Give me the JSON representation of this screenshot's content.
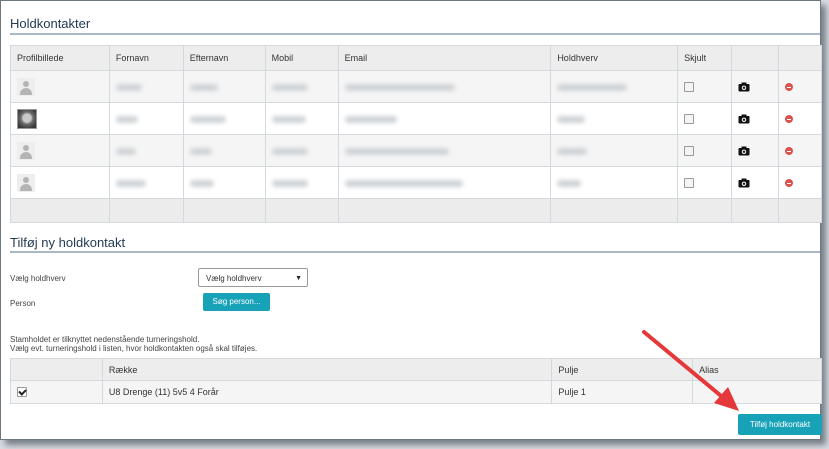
{
  "contacts_section": {
    "title": "Holdkontakter",
    "columns": [
      "Profilbillede",
      "Fornavn",
      "Efternavn",
      "Mobil",
      "Email",
      "Holdhverv",
      "Skjult",
      "",
      ""
    ],
    "rows": [
      {
        "avatar": "placeholder",
        "hidden": false
      },
      {
        "avatar": "photo",
        "hidden": false
      },
      {
        "avatar": "placeholder",
        "hidden": false
      },
      {
        "avatar": "placeholder",
        "hidden": false
      }
    ]
  },
  "add_section": {
    "title": "Tilføj ny holdkontakt",
    "role_label": "Vælg holdhverv",
    "role_select_value": "Vælg holdhverv",
    "person_label": "Person",
    "search_person_button": "Søg person...",
    "note_line1": "Stamholdet er tilknyttet nedenstående turneringshold.",
    "note_line2": "Vælg evt. turneringshold i listen, hvor holdkontakten også skal tilføjes.",
    "teams_table": {
      "columns": [
        "",
        "Række",
        "Pulje",
        "Alias"
      ],
      "rows": [
        {
          "checked": true,
          "row_name": "U8 Drenge (11) 5v5 4 Forår",
          "pool": "Pulje 1",
          "alias": ""
        }
      ]
    },
    "submit_button": "Tilføj holdkontakt"
  },
  "icons": {
    "camera": "camera-icon",
    "delete": "delete-icon",
    "avatar": "user-placeholder-icon",
    "dropdown": "caret-down-icon"
  },
  "colors": {
    "accent": "#17a2b8",
    "title": "#243a55",
    "delete": "#d9534f",
    "annotation_arrow": "#e5383b"
  }
}
